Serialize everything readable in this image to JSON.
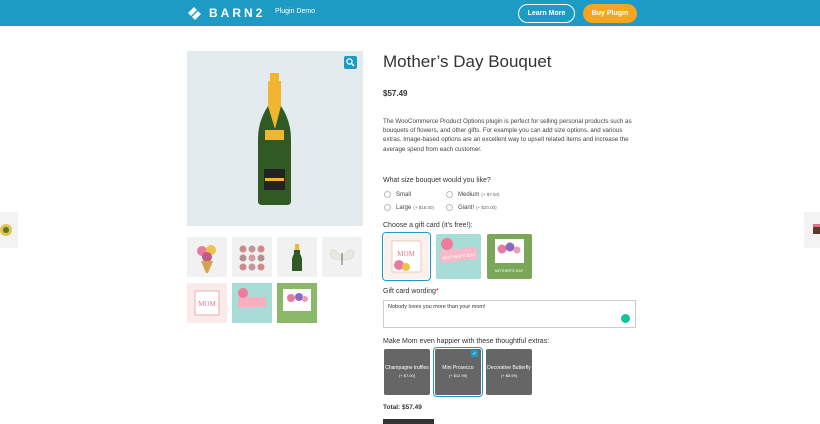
{
  "header": {
    "logo_text": "BARN2",
    "subtitle": "Plugin Demo",
    "learn_more": "Learn More",
    "buy_plugin": "Buy Plugin",
    "brand_color": "#1e9bc4",
    "accent_color": "#f7a51c"
  },
  "product": {
    "title": "Mother’s Day Bouquet",
    "price": "$57.49",
    "description": "The WooCommerce Product Options plugin is perfect for selling personal products such as bouquets of flowers, and other gifts. For example you can add size options, and various extras. Image-based options are an excellent way to upsell related items and increase the average spend from each customer."
  },
  "size": {
    "label": "What size bouquet would you like?",
    "options": [
      {
        "name": "Small",
        "extra": ""
      },
      {
        "name": "Medium",
        "extra": "(+ $7.50)"
      },
      {
        "name": "Large",
        "extra": "(+ $15.00)"
      },
      {
        "name": "Giant!",
        "extra": "(+ $20.00)"
      }
    ]
  },
  "gift_card": {
    "label": "Choose a gift card (it's free!):",
    "card1_text": "MOM",
    "card2_text": "MOTHER'S DAY",
    "card3_text": "MOTHER'S DAY"
  },
  "wording": {
    "label": "Gift card wording",
    "required_mark": "*",
    "value": "Nobody loves you more than your mom!"
  },
  "extras": {
    "label": "Make Mom even happier with these thoughtful extras:",
    "items": [
      {
        "name": "Champagne truffles",
        "price": "(+ $7.00)"
      },
      {
        "name": "Mini Prosecco",
        "price": "(+ $12.99)"
      },
      {
        "name": "Decorative Butterfly",
        "price": "(+ $8.99)"
      }
    ]
  },
  "total": "Total: $57.49",
  "icons": [
    "barn2-logo-icon",
    "zoom-icon",
    "checkmark-icon",
    "grammarly-icon"
  ]
}
